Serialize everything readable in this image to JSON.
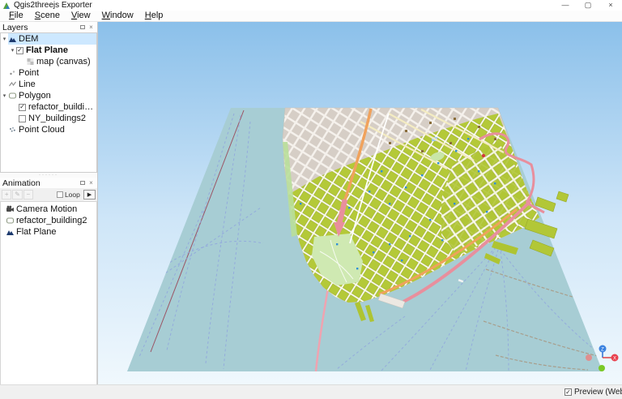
{
  "window": {
    "title": "Qgis2threejs Exporter"
  },
  "menu": {
    "items": [
      "File",
      "Scene",
      "View",
      "Window",
      "Help"
    ]
  },
  "layers_panel": {
    "title": "Layers",
    "items": [
      {
        "label": "DEM"
      },
      {
        "label": "Flat Plane"
      },
      {
        "label": "map (canvas)"
      },
      {
        "label": "Point"
      },
      {
        "label": "Line"
      },
      {
        "label": "Polygon"
      },
      {
        "label": "refactor_buildin..."
      },
      {
        "label": "NY_buildings2"
      },
      {
        "label": "Point Cloud"
      }
    ]
  },
  "animation_panel": {
    "title": "Animation",
    "loop_label": "Loop",
    "items": [
      {
        "label": "Camera Motion"
      },
      {
        "label": "refactor_building2"
      },
      {
        "label": "Flat Plane"
      }
    ]
  },
  "statusbar": {
    "preview_label": "Preview (WebEngine)"
  },
  "viewport": {
    "axis_z_label": "Z",
    "axis_x_label": "X"
  },
  "icons": {
    "expand": "▾",
    "check": "✓",
    "play": "▶",
    "add": "+",
    "edit": "✎",
    "remove": "−",
    "close": "×",
    "minimize": "—",
    "maximize": "▢",
    "dots": "······"
  },
  "colors": {
    "selection": "#cde8ff",
    "sky_top": "#8bc0ea",
    "sky_bottom": "#f0f8fd",
    "water": "#a7cdd4",
    "urban": "#d6cec6",
    "buildings": "#b4c938",
    "park": "#cfe9b2",
    "road_orange": "#f0a25c",
    "road_pink": "#e88f9d",
    "axis_x": "#e8414e",
    "axis_z": "#3b82e0"
  }
}
